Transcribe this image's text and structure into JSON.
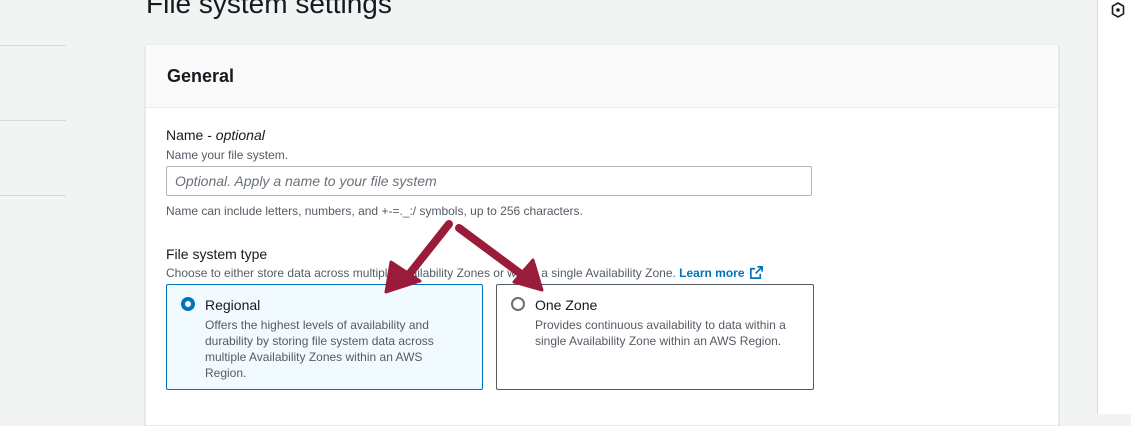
{
  "page": {
    "title": "File system settings"
  },
  "general": {
    "title": "General",
    "name_field": {
      "label": "Name - ",
      "label_optional": "optional",
      "description": "Name your file system.",
      "placeholder": "Optional. Apply a name to your file system",
      "value": "",
      "constraint": "Name can include letters, numbers, and +-=._:/ symbols, up to 256 characters."
    },
    "file_system_type": {
      "label": "File system type",
      "description": "Choose to either store data across multiple Availability Zones or within a single Availability Zone.",
      "learn_more": "Learn more",
      "learn_more_icon": "external-link-icon",
      "selected": "Regional",
      "options": [
        {
          "title": "Regional",
          "description": "Offers the highest levels of availability and durability by storing file system data across multiple Availability Zones within an AWS Region.",
          "selected": true
        },
        {
          "title": "One Zone",
          "description": "Provides continuous availability to data within a single Availability Zone within an AWS Region.",
          "selected": false
        }
      ]
    }
  },
  "right_rail": {
    "icon": "info-panel-icon"
  },
  "colors": {
    "accent": "#0073bb",
    "annotation_arrow": "#9b1b3a",
    "background": "#f2f3f3"
  }
}
